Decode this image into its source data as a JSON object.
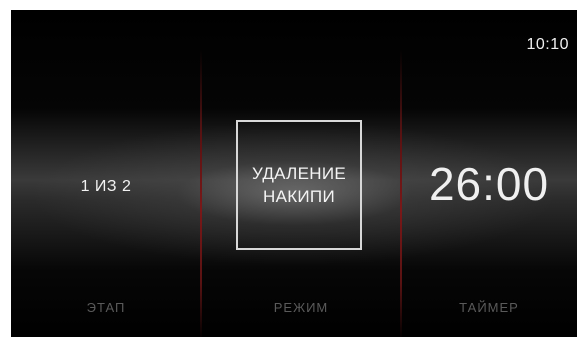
{
  "status": {
    "clock": "10:10"
  },
  "stage": {
    "value": "1 ИЗ 2",
    "label": "ЭТАП"
  },
  "mode": {
    "line1": "УДАЛЕНИЕ",
    "line2": "НАКИПИ",
    "label": "РЕЖИМ"
  },
  "timer": {
    "value": "26:00",
    "label": "ТАЙМЕР"
  },
  "colors": {
    "background": "#000000",
    "divider": "#7a1818",
    "text": "#f0f0f0",
    "label": "#5a5a5a"
  }
}
